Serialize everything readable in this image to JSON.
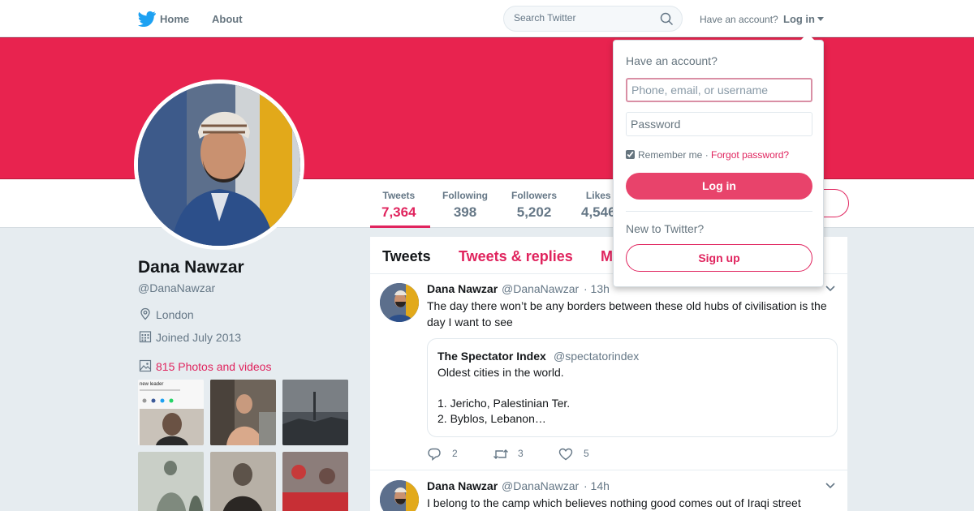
{
  "nav": {
    "home": "Home",
    "about": "About",
    "search_placeholder": "Search Twitter",
    "have_account": "Have an account?",
    "login": "Log in"
  },
  "colors": {
    "brand": "#e8234f",
    "accent": "#e0245e",
    "twitter_blue": "#1da1f2"
  },
  "profile": {
    "name": "Dana Nawzar",
    "handle": "@DanaNawzar",
    "location": "London",
    "joined": "Joined July 2013",
    "photos_link": "815 Photos and videos"
  },
  "stats": [
    {
      "label": "Tweets",
      "value": "7,364"
    },
    {
      "label": "Following",
      "value": "398"
    },
    {
      "label": "Followers",
      "value": "5,202"
    },
    {
      "label": "Likes",
      "value": "4,546"
    }
  ],
  "timeline": {
    "tabs": [
      "Tweets",
      "Tweets & replies",
      "M"
    ],
    "tweets": [
      {
        "name": "Dana Nawzar",
        "handle": "@DanaNawzar",
        "time": "· 13h",
        "text": "The day there won’t be any borders between these old hubs of civilisation is the day I want to see",
        "quote": {
          "name": "The Spectator Index",
          "handle": "@spectatorindex",
          "line1": "Oldest cities in the world.",
          "line2": "1. Jericho, Palestinian Ter.",
          "line3": "2. Byblos, Lebanon…"
        },
        "replies": "2",
        "retweets": "3",
        "likes": "5"
      },
      {
        "name": "Dana Nawzar",
        "handle": "@DanaNawzar",
        "time": "· 14h",
        "text": "I belong to the camp which believes nothing good comes out of Iraqi street"
      }
    ]
  },
  "login_dropdown": {
    "title": "Have an account?",
    "username_placeholder": "Phone, email, or username",
    "password_placeholder": "Password",
    "remember": "Remember me",
    "sep": "·",
    "forgot": "Forgot password?",
    "login_button": "Log in",
    "new_to": "New to Twitter?",
    "signup_button": "Sign up"
  },
  "thumbnails": {
    "t1_caption": "new leader"
  }
}
